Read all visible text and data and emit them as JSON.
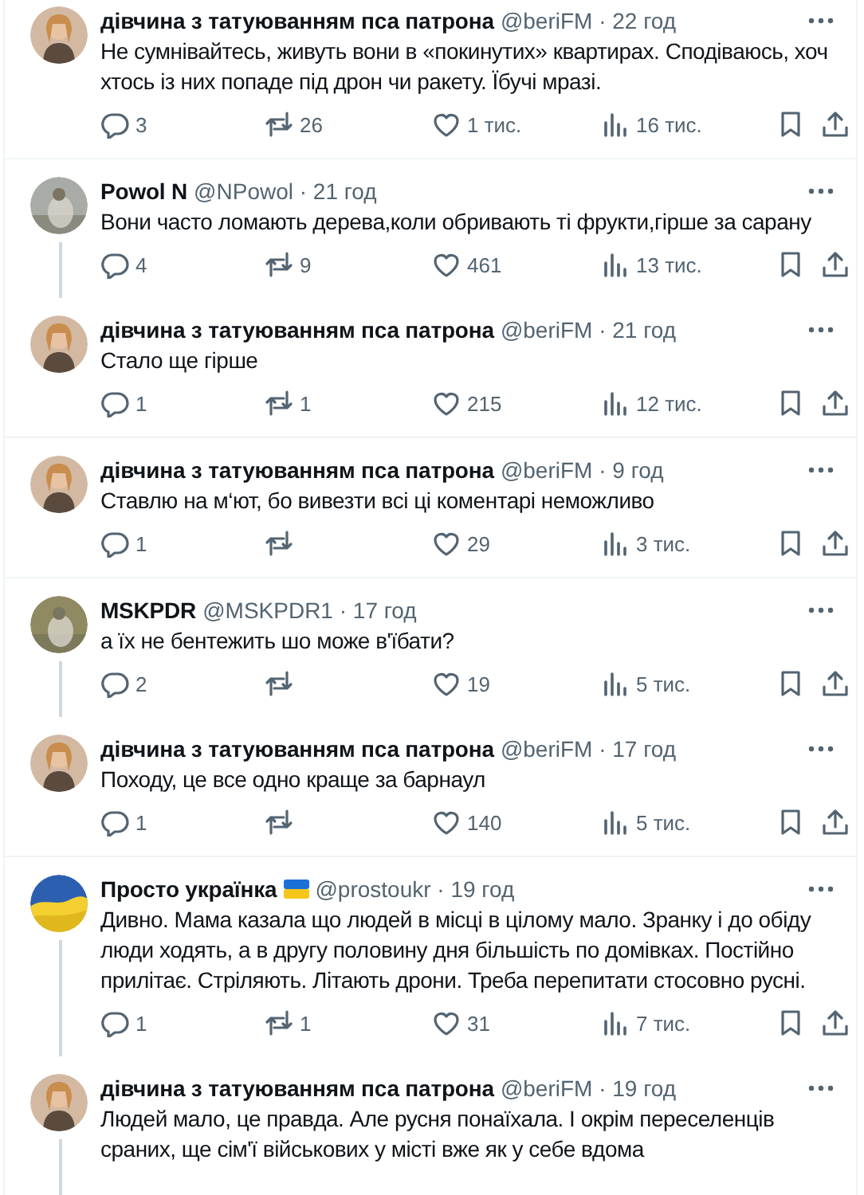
{
  "tweets": [
    {
      "avatar": {
        "kind": "person",
        "color": "#c8a486"
      },
      "name": "дівчина з татуюванням пса патрона",
      "flag": false,
      "meta": "@beriFM · 22 год",
      "text": "Не сумнівайтесь, живуть вони в «покинутих» квартирах. Сподіваюсь, хоч хтось із них попаде під дрон чи ракету. Їбучі мразі.",
      "thread_continues": false,
      "actions": {
        "replies": "3",
        "reposts": "26",
        "likes": "1 тис.",
        "views": "16 тис."
      }
    },
    {
      "avatar": {
        "kind": "photo",
        "color": "#a9aba6"
      },
      "name": "Powol N",
      "flag": false,
      "meta": "@NPowol · 21 год",
      "text": "Вони часто ломають дерева,коли обривають ті фрукти,гірше за сарану",
      "thread_continues": true,
      "actions": {
        "replies": "4",
        "reposts": "9",
        "likes": "461",
        "views": "13 тис."
      }
    },
    {
      "avatar": {
        "kind": "person",
        "color": "#c8a486"
      },
      "name": "дівчина з татуюванням пса патрона",
      "flag": false,
      "meta": "@beriFM · 21 год",
      "text": "Стало ще гірше",
      "thread_continues": false,
      "actions": {
        "replies": "1",
        "reposts": "1",
        "likes": "215",
        "views": "12 тис."
      }
    },
    {
      "avatar": {
        "kind": "person",
        "color": "#c8a486"
      },
      "name": "дівчина з татуюванням пса патрона",
      "flag": false,
      "meta": "@beriFM · 9 год",
      "text": "Ставлю на м‘ют, бо вивезти всі ці коментарі неможливо",
      "thread_continues": false,
      "actions": {
        "replies": "1",
        "likes": "29",
        "views": "3 тис."
      }
    },
    {
      "avatar": {
        "kind": "photo",
        "color": "#8f8a62"
      },
      "name": "MSKPDR",
      "flag": false,
      "meta": "@MSKPDR1 · 17 год",
      "text": "а їх не бентежить шо може в'їбати?",
      "thread_continues": true,
      "actions": {
        "replies": "2",
        "likes": "19",
        "views": "5 тис."
      }
    },
    {
      "avatar": {
        "kind": "person",
        "color": "#c8a486"
      },
      "name": "дівчина з татуюванням пса патрона",
      "flag": false,
      "meta": "@beriFM · 17 год",
      "text": "Походу, це все одно краще за барнаул",
      "thread_continues": false,
      "actions": {
        "replies": "1",
        "likes": "140",
        "views": "5 тис."
      }
    },
    {
      "avatar": {
        "kind": "flag",
        "color": "#2d5fb0"
      },
      "name": "Просто українка",
      "flag": true,
      "meta": "@prostoukr · 19 год",
      "text": "Дивно. Мама казала що людей в місці в цілому мало. Зранку і до обіду люди ходять, а в другу половину дня більшість по домівках. Постійно прилітає. Стріляють. Літають дрони. Треба перепитати стосовно русні.",
      "thread_continues": true,
      "actions": {
        "replies": "1",
        "reposts": "1",
        "likes": "31",
        "views": "7 тис."
      }
    },
    {
      "avatar": {
        "kind": "person",
        "color": "#c8a486"
      },
      "name": "дівчина з татуюванням пса патрона",
      "flag": false,
      "meta": "@beriFM · 19 год",
      "text": "Людей мало, це правда. Але русня понаїхала. І окрім переселенців сраних, ще сім'ї військових у місті вже як у себе вдома",
      "thread_continues": true
    }
  ]
}
